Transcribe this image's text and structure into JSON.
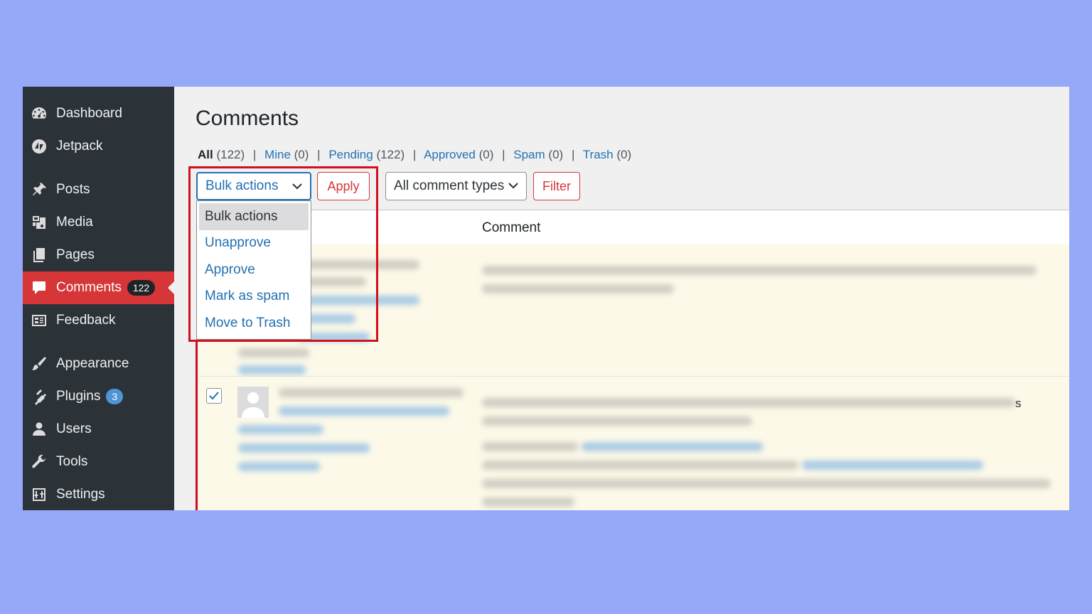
{
  "sidebar": {
    "items": [
      {
        "label": "Dashboard",
        "icon": "dashboard-icon"
      },
      {
        "label": "Jetpack",
        "icon": "jetpack-icon"
      },
      {
        "label": "Posts",
        "icon": "pin-icon"
      },
      {
        "label": "Media",
        "icon": "media-icon"
      },
      {
        "label": "Pages",
        "icon": "pages-icon"
      },
      {
        "label": "Comments",
        "icon": "comment-icon",
        "badge": "122",
        "active": true
      },
      {
        "label": "Feedback",
        "icon": "feedback-icon"
      },
      {
        "label": "Appearance",
        "icon": "brush-icon"
      },
      {
        "label": "Plugins",
        "icon": "plug-icon",
        "badge": "3"
      },
      {
        "label": "Users",
        "icon": "user-icon"
      },
      {
        "label": "Tools",
        "icon": "wrench-icon"
      },
      {
        "label": "Settings",
        "icon": "sliders-icon"
      }
    ]
  },
  "page": {
    "title": "Comments"
  },
  "filters": {
    "all": {
      "label": "All",
      "count": "(122)"
    },
    "mine": {
      "label": "Mine",
      "count": "(0)"
    },
    "pending": {
      "label": "Pending",
      "count": "(122)"
    },
    "approved": {
      "label": "Approved",
      "count": "(0)"
    },
    "spam": {
      "label": "Spam",
      "count": "(0)"
    },
    "trash": {
      "label": "Trash",
      "count": "(0)"
    },
    "separator": "|"
  },
  "toolbar": {
    "bulk_select_value": "Bulk actions",
    "apply_label": "Apply",
    "type_select_value": "All comment types",
    "filter_label": "Filter"
  },
  "bulk_options": [
    {
      "label": "Bulk actions",
      "selected": true
    },
    {
      "label": "Unapprove"
    },
    {
      "label": "Approve"
    },
    {
      "label": "Mark as spam"
    },
    {
      "label": "Move to Trash"
    }
  ],
  "table": {
    "comment_header": "Comment",
    "row2_checked": true,
    "row2_trailing_char": "s"
  },
  "colors": {
    "sidebar_bg": "#2c3338",
    "active_item": "#d63638",
    "link": "#2271b1",
    "highlight": "#d0101c",
    "row_bg": "#fcf9e8",
    "page_bg": "#96a8f8"
  }
}
